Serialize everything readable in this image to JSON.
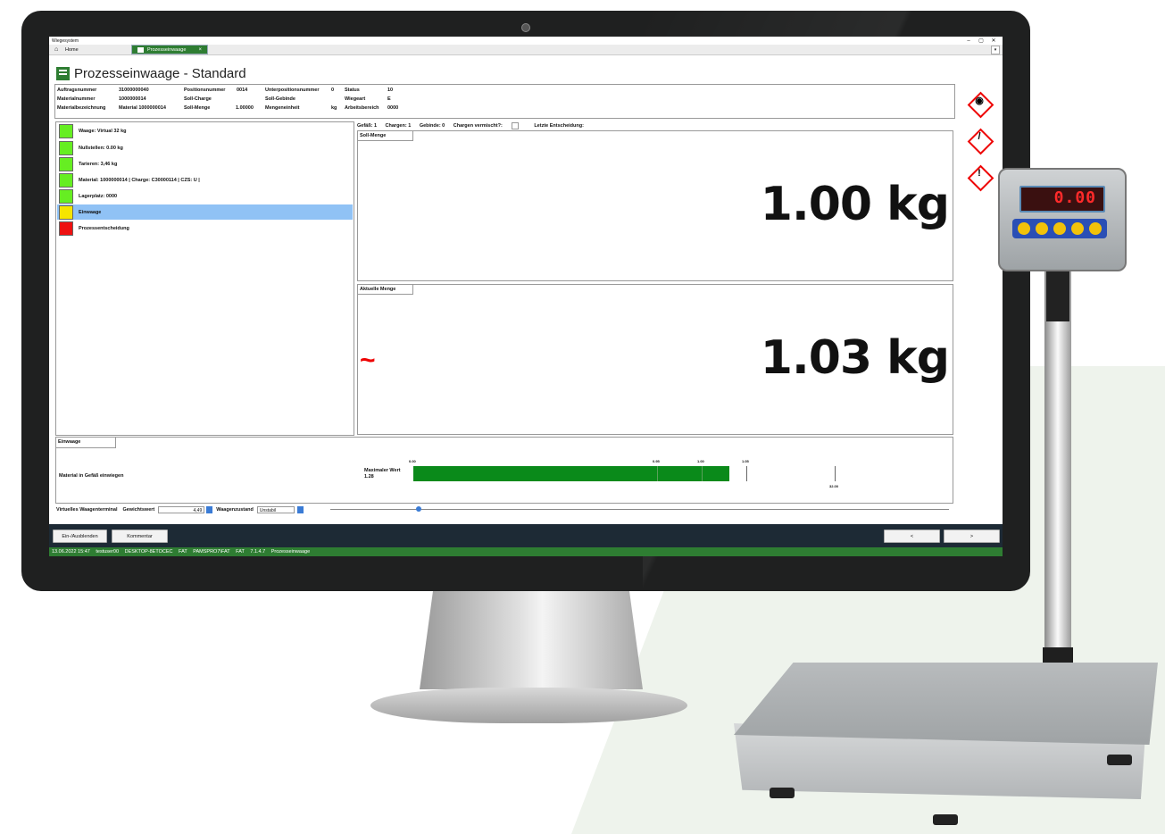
{
  "window": {
    "title": "Wiegesystem",
    "controls": [
      "–",
      "▢",
      "✕"
    ]
  },
  "tabs": [
    {
      "label": "Home",
      "icon": "home-icon",
      "active": false
    },
    {
      "label": "Prozesseinwaage",
      "icon": "scale-icon",
      "active": true,
      "close": "×"
    }
  ],
  "tab_overflow": "▾",
  "page": {
    "title": "Prozesseinwaage - Standard"
  },
  "order_info": {
    "auftragsnummer_label": "Auftragsnummer",
    "auftragsnummer_value": "31000000040",
    "materialnummer_label": "Materialnummer",
    "materialnummer_value": "1000000014",
    "materialbezeichnung_label": "Materialbezeichnung",
    "materialbezeichnung_value": "Material 1000000014",
    "positionsnummer_label": "Positionsnummer",
    "positionsnummer_value": "0014",
    "soll_charge_label": "Soll-Charge",
    "soll_charge_value": "",
    "soll_menge_label": "Soll-Menge",
    "soll_menge_value": "1.00000",
    "unterpositionsnummer_label": "Unterpositionsnummer",
    "unterpositionsnummer_value": "0",
    "soll_gebinde_label": "Soll-Gebinde",
    "soll_gebinde_value": "",
    "mengeneinheit_label": "Mengeneinheit",
    "mengeneinheit_value": "kg",
    "status_label": "Status",
    "status_value": "10",
    "wiegeart_label": "Wiegeart",
    "wiegeart_value": "E",
    "arbeitsbereich_label": "Arbeitsbereich",
    "arbeitsbereich_value": "0000"
  },
  "hazards": [
    "oxidizing-hazard-icon",
    "gas-cylinder-hazard-icon",
    "exclamation-hazard-icon"
  ],
  "steps": [
    {
      "label": "Waage: Virtual 32 kg",
      "color": "#66ee22"
    },
    {
      "label": "Nullstellen: 0.00 kg",
      "color": "#66ee22"
    },
    {
      "label": "Tarieren: 3,46 kg",
      "color": "#66ee22"
    },
    {
      "label": "Material: 1000000014 | Charge: C30000114 | CZS: U |",
      "color": "#66ee22"
    },
    {
      "label": "Lagerplatz: 0000",
      "color": "#66ee22"
    },
    {
      "label": "Einwaage",
      "color": "#f5e500",
      "active": true
    },
    {
      "label": "Prozessentscheidung",
      "color": "#ee1111"
    }
  ],
  "container_info": {
    "gefaess": "Gefäß: 1",
    "chargen": "Chargen: 1",
    "gebinde": "Gebinde: 0",
    "chargen_vermischt": "Chargen vermischt?:",
    "letzte_entscheidung": "Letzte Entscheidung:"
  },
  "soll_menge_panel": {
    "label": "Soll-Menge",
    "value": "1.00 kg"
  },
  "aktuelle_menge_panel": {
    "label": "Aktuelle Menge",
    "value": "1.03 kg",
    "unstable_symbol": "~"
  },
  "einwaage_panel": {
    "label": "Einwaage",
    "instruction": "Material in Gefäß einwiegen",
    "max_label": "Maximaler Wert",
    "max_value": "1.28",
    "bar_min": 0.0,
    "bar_fill": 1.28,
    "ticks": [
      "0.00",
      "0.95",
      "1.00",
      "1.05",
      "32.00"
    ],
    "bar_color": "#0a8a1a"
  },
  "virtual_terminal": {
    "label": "Virtuelles Waagenterminal",
    "gewichtswert_label": "Gewichtswert",
    "gewichtswert_value": "4,49",
    "waagenzustand_label": "Waagenzustand",
    "waagenzustand_value": "Unstabil"
  },
  "footer": {
    "toggle_button": "Ein-/Ausblenden",
    "comment_button": "Kommentar",
    "prev_button": "<",
    "next_button": ">"
  },
  "status_bar": {
    "datetime": "13.06.2022 15:47",
    "user": "testuser00",
    "host": "DESKTOP-8ETOCEC",
    "env": "FAT",
    "path": "PAMSPRO7\\FAT",
    "env2": "FAT",
    "version": "7.1.4.7",
    "module": "Prozesseinwaage"
  },
  "scale_display": "0.00",
  "colors": {
    "accent": "#2e7d32",
    "active_step": "#90c2f5",
    "footer_bg": "#1d2a35",
    "hazard_red": "#ee0000"
  }
}
